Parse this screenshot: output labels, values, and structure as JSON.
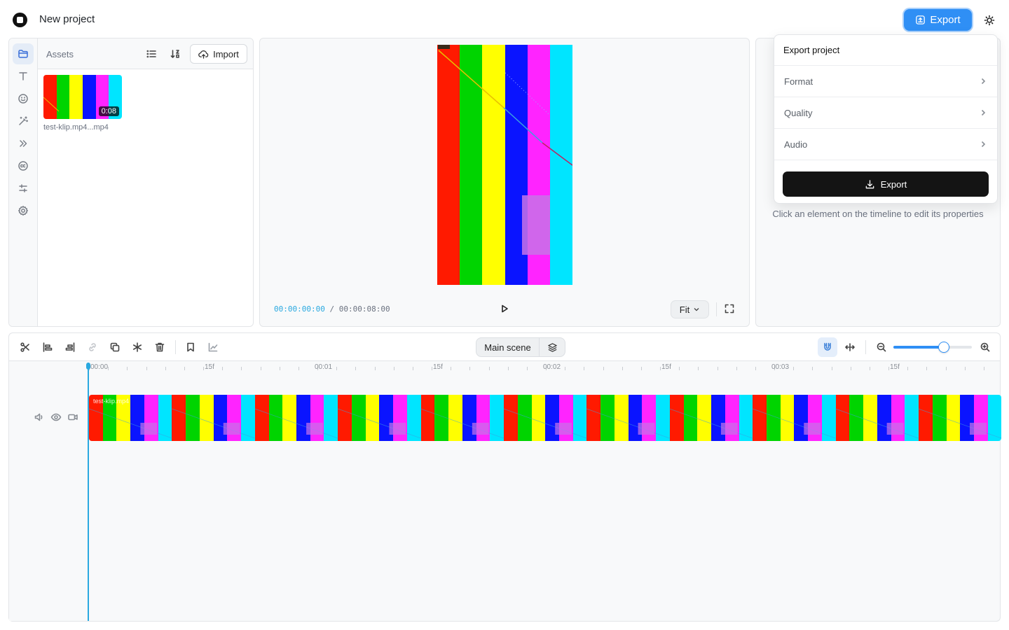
{
  "header": {
    "project_title": "New project",
    "export_label": "Export"
  },
  "sidebar": {
    "items": [
      "media",
      "text",
      "stickers",
      "effects",
      "transitions",
      "captions",
      "adjust",
      "settings"
    ],
    "active": "media"
  },
  "assets": {
    "title": "Assets",
    "import_label": "Import",
    "items": [
      {
        "name": "test-klip.mp4...mp4",
        "duration": "0:08"
      }
    ]
  },
  "preview": {
    "current_time": "00:00:00:00",
    "separator": "/",
    "total_time": "00:00:08:00",
    "fit_label": "Fit",
    "bar_colors": [
      "#ff1a00",
      "#00d400",
      "#ffff00",
      "#0a14ff",
      "#ff24ff",
      "#00e5ff"
    ]
  },
  "properties": {
    "hint": "Click an element on the timeline to edit its properties"
  },
  "export_menu": {
    "title": "Export project",
    "rows": [
      {
        "label": "Format"
      },
      {
        "label": "Quality"
      },
      {
        "label": "Audio"
      }
    ],
    "button_label": "Export"
  },
  "timeline": {
    "scene_label": "Main scene",
    "zoom_level": 0.64,
    "ruler_labels": [
      "00:00",
      "15f",
      "00:01",
      "15f",
      "00:02",
      "15f",
      "00:03",
      "15f"
    ],
    "clip_name": "test-klip.mp4",
    "clip_pattern": [
      "#ff1a00",
      "#00d400",
      "#ffff00",
      "#0a14ff",
      "#ff24ff",
      "#00e5ff"
    ],
    "clip_repeats": 11
  },
  "colors": {
    "accent": "#2f8ff5",
    "playhead": "#2aa9e0",
    "time_current": "#2aa9e0"
  }
}
